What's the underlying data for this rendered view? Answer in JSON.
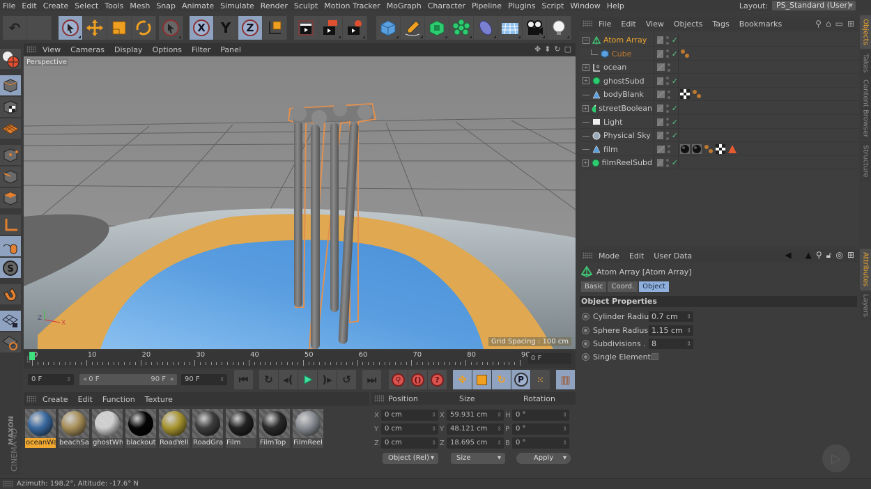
{
  "menubar": {
    "items": [
      "File",
      "Edit",
      "Create",
      "Select",
      "Tools",
      "Mesh",
      "Snap",
      "Animate",
      "Simulate",
      "Render",
      "Sculpt",
      "Motion Tracker",
      "MoGraph",
      "Character",
      "Pipeline",
      "Plugins",
      "Script",
      "Window",
      "Help"
    ],
    "layout_label": "Layout:",
    "layout_value": "PS_Standard (User)"
  },
  "toolbar": {
    "groups": [
      [
        "undo-icon",
        "redo-icon"
      ],
      [
        "live-selection-icon",
        "move-icon",
        "scale-icon",
        "rotate-icon"
      ],
      [
        "last-tool-icon"
      ],
      [
        "x-axis-icon",
        "y-axis-icon",
        "z-axis-icon",
        "coordinate-system-icon"
      ],
      [
        "render-view-icon",
        "render-picture-viewer-icon",
        "render-settings-icon"
      ],
      [
        "cube-icon",
        "pen-icon",
        "subdivision-icon",
        "mograph-cloner-icon",
        "deformer-icon",
        "floor-icon",
        "camera-icon",
        "light-icon"
      ]
    ]
  },
  "left_toolbar": {
    "items": [
      "make-editable-icon",
      "model-mode-icon",
      "texture-mode-icon",
      "workplane-icon",
      "points-mode-icon",
      "edges-mode-icon",
      "polygons-mode-icon",
      "axis-mode-icon",
      "tweak-mode-icon",
      "solo-icon",
      "snap-icon",
      "lock-workplane-icon",
      "workplane-settings-icon"
    ],
    "brand_top": "MAXON",
    "brand_bottom": "CINEMA 4D"
  },
  "viewport": {
    "menu": [
      "View",
      "Cameras",
      "Display",
      "Options",
      "Filter",
      "Panel"
    ],
    "camera_label": "Perspective",
    "grid_spacing": "Grid Spacing : 100 cm",
    "axis_labels": [
      "Z",
      "X"
    ]
  },
  "timeline": {
    "ticks": [
      "0",
      "10",
      "20",
      "30",
      "40",
      "50",
      "60",
      "70",
      "80",
      "90"
    ],
    "current_frame": 0,
    "max_frame": 90,
    "frame_field": "0 F"
  },
  "transport": {
    "start_field": "0 F",
    "range_min": "0 F",
    "range_max": "90 F",
    "end_field": "90 F"
  },
  "materials": {
    "menu": [
      "Create",
      "Edit",
      "Function",
      "Texture"
    ],
    "items": [
      {
        "name": "oceanWa",
        "color": "#3a6aa0",
        "selected": true
      },
      {
        "name": "beachSa",
        "color": "#a8905a",
        "selected": false
      },
      {
        "name": "ghostWh",
        "color": "#cfcfcf",
        "selected": false
      },
      {
        "name": "blackout",
        "color": "#050505",
        "selected": false
      },
      {
        "name": "RoadYell",
        "color": "#a89530",
        "selected": false
      },
      {
        "name": "RoadGra",
        "color": "#3e3e3e",
        "selected": false
      },
      {
        "name": "Film",
        "color": "#222222",
        "selected": false
      },
      {
        "name": "FilmTop",
        "color": "#2a2a2a",
        "selected": false
      },
      {
        "name": "FilmReel",
        "color": "#8a8e94",
        "selected": false
      }
    ]
  },
  "coordinates": {
    "headers": [
      "Position",
      "Size",
      "Rotation"
    ],
    "rows": [
      {
        "pl": "X",
        "pv": "0 cm",
        "sl": "X",
        "sv": "59.931 cm",
        "rl": "H",
        "rv": "0 °"
      },
      {
        "pl": "Y",
        "pv": "0 cm",
        "sl": "Y",
        "sv": "48.121 cm",
        "rl": "P",
        "rv": "0 °"
      },
      {
        "pl": "Z",
        "pv": "0 cm",
        "sl": "Z",
        "sv": "18.695 cm",
        "rl": "B",
        "rv": "0 °"
      }
    ],
    "mode_dropdown": "Object (Rel)",
    "size_dropdown": "Size",
    "apply_label": "Apply"
  },
  "status": {
    "text": "Azimuth: 198.2°, Altitude: -17.6°  N"
  },
  "object_manager": {
    "menu": [
      "File",
      "Edit",
      "View",
      "Objects",
      "Tags",
      "Bookmarks"
    ],
    "objects": [
      {
        "name": "Atom Array",
        "icon": "atom-array-icon",
        "expand": "−",
        "indent": 0,
        "active": true,
        "check": true,
        "tags": []
      },
      {
        "name": "Cube",
        "icon": "cube-icon",
        "expand": "",
        "indent": 1,
        "active": false,
        "child": true,
        "check": true,
        "tags": [
          "texture-tag-icon"
        ]
      },
      {
        "name": "ocean",
        "icon": "null-icon",
        "expand": "+",
        "indent": 0,
        "check": false,
        "tags": []
      },
      {
        "name": "ghostSubd",
        "icon": "subdivision-icon",
        "expand": "+",
        "indent": 0,
        "check": true,
        "tags": []
      },
      {
        "name": "bodyBlank",
        "icon": "polygon-icon",
        "expand": "",
        "indent": 0,
        "check": false,
        "tags": [
          "checker-tag-icon",
          "texture-tag-icon"
        ]
      },
      {
        "name": "streetBoolean",
        "icon": "boole-icon",
        "expand": "+",
        "indent": 0,
        "check": true,
        "tags": []
      },
      {
        "name": "Light",
        "icon": "light-icon",
        "expand": "",
        "indent": 0,
        "check": true,
        "tags": []
      },
      {
        "name": "Physical Sky",
        "icon": "sky-icon",
        "expand": "",
        "indent": 0,
        "check": true,
        "tags": []
      },
      {
        "name": "film",
        "icon": "polygon-icon",
        "expand": "",
        "indent": 0,
        "check": false,
        "tags": [
          "material-tag-icon",
          "material-tag-icon",
          "texture-tag-icon",
          "checker-tag-icon",
          "warning-tag-icon"
        ]
      },
      {
        "name": "filmReelSubd",
        "icon": "subdivision-icon",
        "expand": "+",
        "indent": 0,
        "check": true,
        "tags": []
      }
    ]
  },
  "side_tabs_top": [
    "Objects",
    "Takes",
    "Content Browser",
    "Structure"
  ],
  "side_tabs_bottom": [
    "Attributes",
    "Layers"
  ],
  "attributes": {
    "menu": [
      "Mode",
      "Edit",
      "User Data"
    ],
    "title": "Atom Array [Atom Array]",
    "tabs": [
      {
        "label": "Basic",
        "active": false
      },
      {
        "label": "Coord.",
        "active": false
      },
      {
        "label": "Object",
        "active": true
      }
    ],
    "section": "Object Properties",
    "props": [
      {
        "label": "Cylinder Radius",
        "value": "0.7 cm"
      },
      {
        "label": "Sphere Radius",
        "value": "1.15 cm"
      },
      {
        "label": "Subdivisions . .",
        "value": "8"
      },
      {
        "label": "Single Elements",
        "checked": false
      }
    ]
  },
  "colors": {
    "accent_orange": "#f0a830",
    "active_blue": "#8fa3c0",
    "check_green": "#5ac88a"
  }
}
